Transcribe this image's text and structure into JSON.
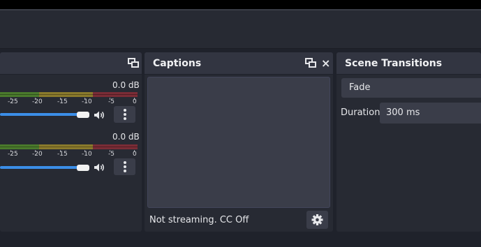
{
  "mixer": {
    "channels": [
      {
        "level": "0.0 dB"
      },
      {
        "level": "0.0 dB"
      }
    ],
    "ticks": [
      "-25",
      "-20",
      "-15",
      "-10",
      "-5",
      "0"
    ]
  },
  "captions": {
    "title": "Captions",
    "status": "Not streaming. CC Off"
  },
  "transitions": {
    "title": "Scene Transitions",
    "selected": "Fade",
    "duration_label": "Duration",
    "duration_value": "300 ms"
  },
  "colors": {
    "meter_green": "#4a7a2c",
    "meter_yellow": "#8a7a2c",
    "meter_red": "#7a2c36",
    "slider": "#3b8ee8"
  },
  "icons": [
    "float-icon",
    "close-icon",
    "volume-icon",
    "kebab-menu-icon",
    "gear-icon"
  ]
}
